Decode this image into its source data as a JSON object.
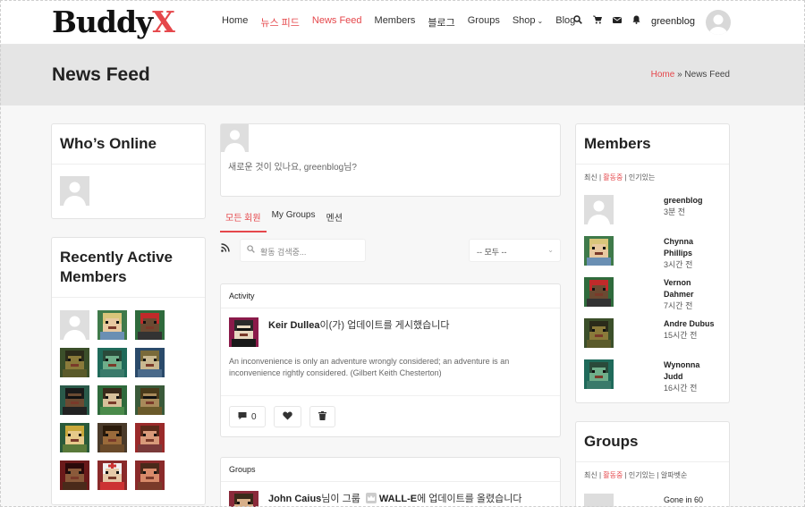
{
  "brand": {
    "logo_main": "Buddy",
    "logo_x": "X"
  },
  "nav": {
    "items": [
      {
        "label": "Home"
      },
      {
        "label": "뉴스 피드"
      },
      {
        "label": "News Feed"
      },
      {
        "label": "Members"
      },
      {
        "label": "블로그"
      },
      {
        "label": "Groups"
      },
      {
        "label": "Shop"
      },
      {
        "label": "Blog"
      }
    ],
    "shop_chevron": "⌄"
  },
  "header_icons": {
    "search": "search-icon",
    "cart": "cart-icon",
    "mail": "mail-icon",
    "bell": "bell-icon",
    "username": "greenblog"
  },
  "page": {
    "title": "News Feed",
    "breadcrumb_home": "Home",
    "breadcrumb_sep": " » ",
    "breadcrumb_current": "News Feed"
  },
  "whos_online": {
    "title": "Who’s Online"
  },
  "recent_members": {
    "title": "Recently Active Members"
  },
  "composer": {
    "placeholder": "새로운 것이 있나요, greenblog님?"
  },
  "feed_tabs": [
    {
      "label": "모든 회원"
    },
    {
      "label": "My Groups"
    },
    {
      "label": "멘션"
    }
  ],
  "filter": {
    "search_placeholder": "활동 검색중...",
    "select_value": "-- 모두 --"
  },
  "activity": {
    "type_label": "Activity",
    "author": "Keir Dullea",
    "action": "이(가) 업데이트를 게시했습니다",
    "text": "An inconvenience is only an adventure wrongly considered; an adventure is an inconvenience rightly considered. (Gilbert Keith Chesterton)",
    "comment_count": "0"
  },
  "groups_card": {
    "type_label": "Groups",
    "author": "John Caius",
    "action_pre": "님이 그룹",
    "group": "WALL-E",
    "action_post": "에 업데이트를 올렸습니다"
  },
  "members_widget": {
    "title": "Members",
    "tab_newest": "최신",
    "tab_active": "활동중",
    "tab_popular": "인기있는",
    "separator": " | ",
    "list": [
      {
        "name": "greenblog",
        "time": "3분 전"
      },
      {
        "name": "Chynna Phillips",
        "time": "3시간 전"
      },
      {
        "name": "Vernon Dahmer",
        "time": "7시간 전"
      },
      {
        "name": "Andre Dubus",
        "time": "15시간 전"
      },
      {
        "name": "Wynonna Judd",
        "time": "16시간 전"
      }
    ]
  },
  "groups_widget": {
    "title": "Groups",
    "tab_newest": "최신",
    "tab_active": "활동중",
    "tab_popular": "인기있는",
    "tab_alpha": "알파벳순",
    "first_item": "Gone in 60"
  },
  "colors": {
    "accent": "#e5474b",
    "bg": "#f7f7f7",
    "subheader": "#e5e5e5"
  }
}
